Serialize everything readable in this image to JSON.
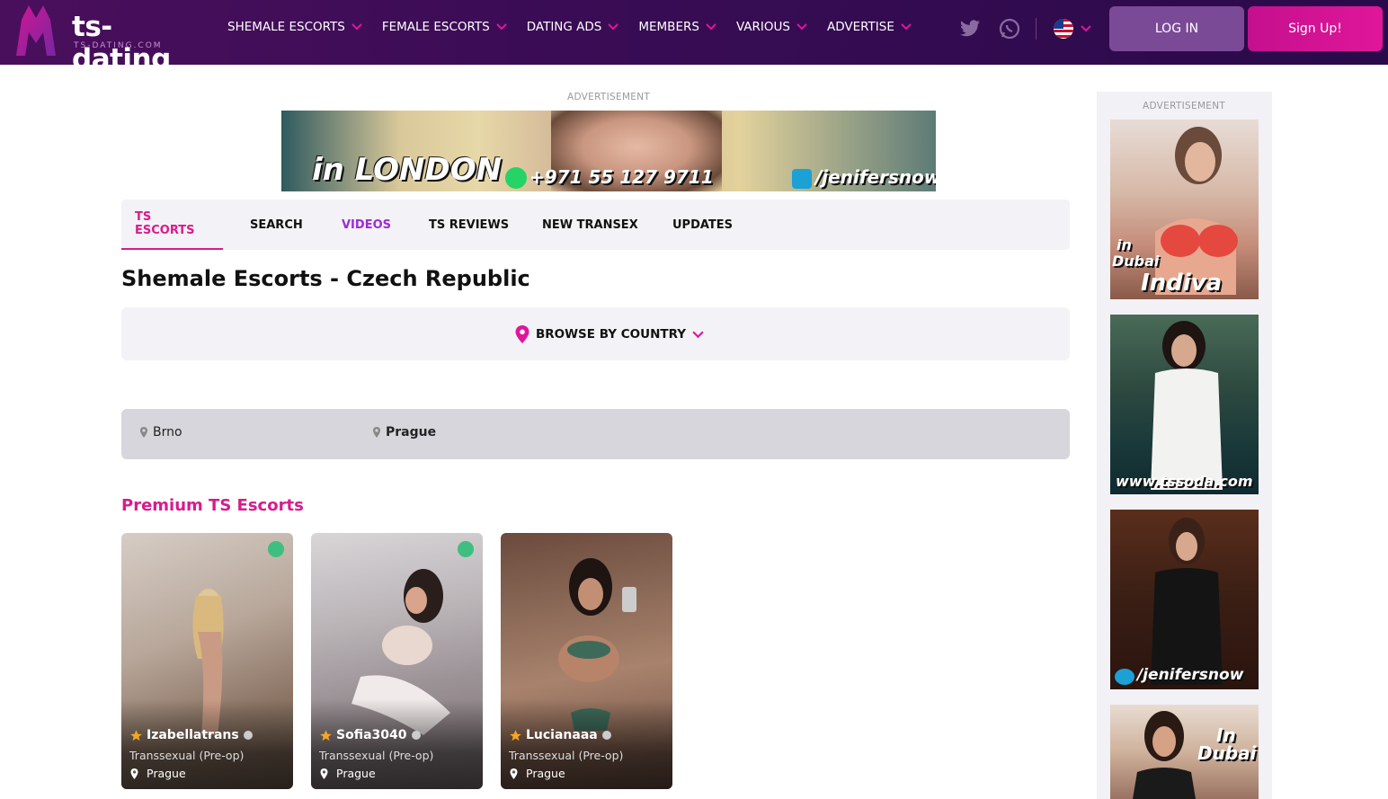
{
  "header": {
    "logo_text": "ts-dating",
    "logo_sub": "TS-DATING.COM",
    "nav": [
      {
        "label": "SHEMALE ESCORTS"
      },
      {
        "label": "FEMALE ESCORTS"
      },
      {
        "label": "DATING ADS"
      },
      {
        "label": "MEMBERS"
      },
      {
        "label": "VARIOUS"
      },
      {
        "label": "ADVERTISE"
      }
    ],
    "login_label": "LOG IN",
    "signup_label": "Sign Up!"
  },
  "ads": {
    "label": "ADVERTISEMENT",
    "banner_city": "in LONDON",
    "banner_phone": "+971 55 127 9711",
    "banner_handle": "/jenifersnow"
  },
  "tabs": [
    {
      "label": "TS ESCORTS"
    },
    {
      "label": "SEARCH"
    },
    {
      "label": "VIDEOS"
    },
    {
      "label": "TS REVIEWS"
    },
    {
      "label": "NEW TRANSEX"
    },
    {
      "label": "UPDATES"
    }
  ],
  "page_title": "Shemale Escorts - Czech Republic",
  "browse_label": "BROWSE BY COUNTRY",
  "cities": [
    {
      "label": "Brno"
    },
    {
      "label": "Prague"
    }
  ],
  "section_title": "Premium TS Escorts",
  "cards": [
    {
      "name": "Izabellatrans",
      "type": "Transsexual (Pre-op)",
      "location": "Prague"
    },
    {
      "name": "Sofia3040",
      "type": "Transsexual (Pre-op)",
      "location": "Prague"
    },
    {
      "name": "Lucianaaa",
      "type": "Transsexual (Pre-op)",
      "location": "Prague"
    }
  ],
  "sidebar": {
    "label": "ADVERTISEMENT",
    "ad1_line1": "in",
    "ad1_line2": "Dubai",
    "ad1_name": "Indiva",
    "ad2_url": "www.tssoda.com",
    "ad3_handle": "/jenifersnow",
    "ad4_line1": "In",
    "ad4_line2": "Dubai"
  },
  "colors": {
    "accent": "#d81b8c",
    "videos": "#9b2bd6",
    "header": "#3a0c55"
  }
}
